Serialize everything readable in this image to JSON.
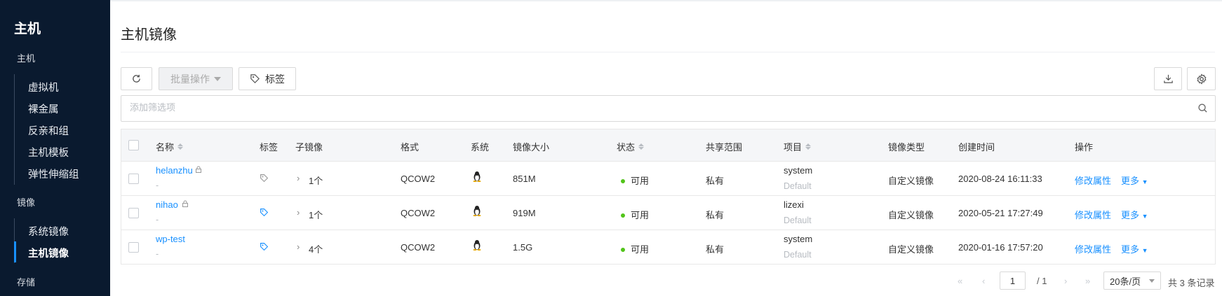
{
  "sidebar": {
    "title": "主机",
    "groups": [
      {
        "label": "主机",
        "items": [
          "虚拟机",
          "裸金属",
          "反亲和组",
          "主机模板",
          "弹性伸缩组"
        ]
      },
      {
        "label": "镜像",
        "items": [
          "系统镜像",
          "主机镜像"
        ]
      },
      {
        "label": "存储"
      }
    ],
    "active_item": "主机镜像"
  },
  "page": {
    "title": "主机镜像"
  },
  "toolbar": {
    "refresh_icon": "refresh-icon",
    "batch_label": "批量操作",
    "tag_label": "标签",
    "download_icon": "download-icon",
    "settings_icon": "gear-icon"
  },
  "search": {
    "placeholder": "添加筛选项",
    "value": ""
  },
  "table": {
    "columns": [
      "名称",
      "标签",
      "子镜像",
      "格式",
      "系统",
      "镜像大小",
      "状态",
      "共享范围",
      "项目",
      "镜像类型",
      "创建时间",
      "操作"
    ],
    "rows": [
      {
        "name": "helanzhu",
        "sub": "-",
        "children": "1个",
        "format": "QCOW2",
        "size": "851M",
        "status": "可用",
        "share": "私有",
        "project": "system",
        "project_sub": "Default",
        "type": "自定义镜像",
        "created": "2020-08-24 16:11:33",
        "action": "修改属性",
        "more": "更多",
        "locked": true,
        "tagged": false
      },
      {
        "name": "nihao",
        "sub": "-",
        "children": "1个",
        "format": "QCOW2",
        "size": "919M",
        "status": "可用",
        "share": "私有",
        "project": "lizexi",
        "project_sub": "Default",
        "type": "自定义镜像",
        "created": "2020-05-21 17:27:49",
        "action": "修改属性",
        "more": "更多",
        "locked": true,
        "tagged": true
      },
      {
        "name": "wp-test",
        "sub": "-",
        "children": "4个",
        "format": "QCOW2",
        "size": "1.5G",
        "status": "可用",
        "share": "私有",
        "project": "system",
        "project_sub": "Default",
        "type": "自定义镜像",
        "created": "2020-01-16 17:57:20",
        "action": "修改属性",
        "more": "更多",
        "locked": false,
        "tagged": true
      }
    ]
  },
  "pagination": {
    "current_page": "1",
    "total_pages": "/ 1",
    "page_size": "20条/页",
    "total": "共 3 条记录"
  },
  "colors": {
    "sidebar_bg": "#0a1a2f",
    "accent": "#1890ff",
    "status_ok": "#52c41a"
  }
}
